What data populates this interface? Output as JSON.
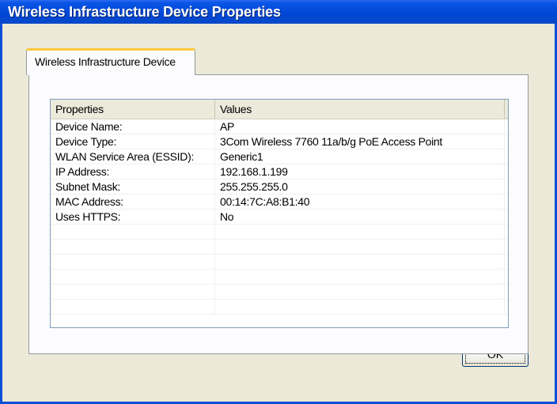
{
  "window": {
    "title": "Wireless Infrastructure Device Properties"
  },
  "tabs": [
    {
      "label": "Wireless Infrastructure Device",
      "selected": true
    }
  ],
  "table": {
    "columns": [
      "Properties",
      "Values"
    ],
    "rows": [
      {
        "property": "Device Name:",
        "value": "AP"
      },
      {
        "property": "Device Type:",
        "value": "3Com Wireless 7760 11a/b/g PoE Access Point"
      },
      {
        "property": "WLAN Service Area (ESSID):",
        "value": "Generic1"
      },
      {
        "property": "IP Address:",
        "value": "192.168.1.199"
      },
      {
        "property": "Subnet Mask:",
        "value": "255.255.255.0"
      },
      {
        "property": "MAC Address:",
        "value": "00:14:7C:A8:B1:40"
      },
      {
        "property": "Uses HTTPS:",
        "value": "No"
      },
      {
        "property": "",
        "value": ""
      },
      {
        "property": "",
        "value": ""
      },
      {
        "property": "",
        "value": ""
      },
      {
        "property": "",
        "value": ""
      },
      {
        "property": "",
        "value": ""
      },
      {
        "property": "",
        "value": ""
      }
    ]
  },
  "buttons": {
    "ok_label": "OK"
  },
  "colors": {
    "titlebar": "#0046d5",
    "client_bg": "#ece9d8",
    "tab_highlight": "#ffc83c"
  }
}
